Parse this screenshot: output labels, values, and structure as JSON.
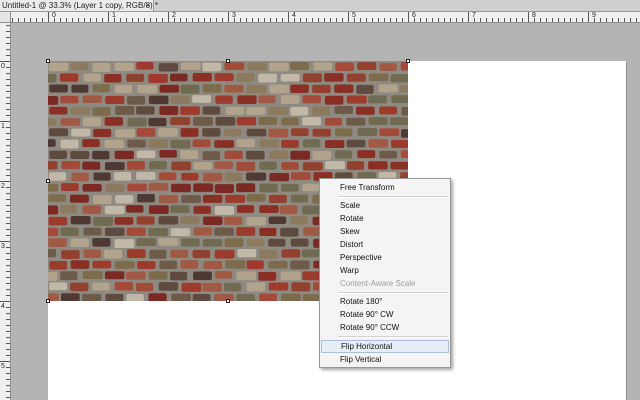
{
  "document_tab": {
    "title": "Untitled-1 @ 33.3% (Layer 1 copy, RGB/8) *",
    "close_glyph": "×"
  },
  "ruler": {
    "top_labels": [
      "0",
      "1",
      "2",
      "3",
      "4",
      "5",
      "6",
      "7",
      "8",
      "9"
    ],
    "left_labels": [
      "0",
      "1",
      "2",
      "3",
      "4",
      "5"
    ]
  },
  "context_menu": {
    "items": [
      {
        "label": "Free Transform",
        "enabled": true
      },
      {
        "label": "Scale",
        "enabled": true
      },
      {
        "label": "Rotate",
        "enabled": true
      },
      {
        "label": "Skew",
        "enabled": true
      },
      {
        "label": "Distort",
        "enabled": true
      },
      {
        "label": "Perspective",
        "enabled": true
      },
      {
        "label": "Warp",
        "enabled": true
      },
      {
        "label": "Content-Aware Scale",
        "enabled": false
      },
      {
        "label": "Rotate 180°",
        "enabled": true
      },
      {
        "label": "Rotate 90° CW",
        "enabled": true
      },
      {
        "label": "Rotate 90° CCW",
        "enabled": true
      },
      {
        "label": "Flip Horizontal",
        "enabled": true,
        "highlighted": true
      },
      {
        "label": "Flip Vertical",
        "enabled": true
      }
    ]
  },
  "colors": {
    "workspace": "#b4b4b4",
    "menu_highlight": "#e6eef8"
  }
}
